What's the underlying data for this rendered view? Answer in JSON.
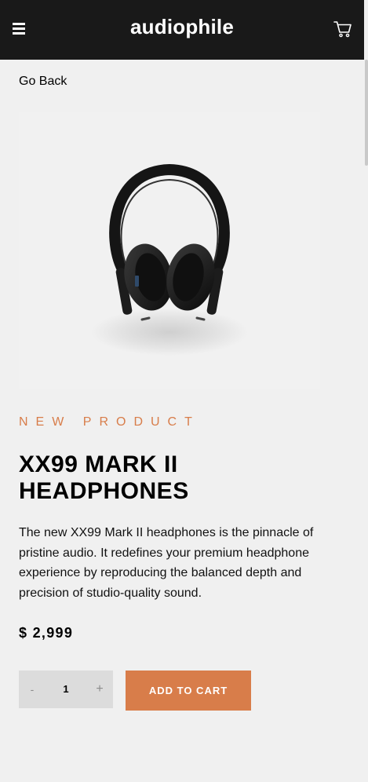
{
  "header": {
    "logo": "audiophile",
    "menu_icon": "hamburger-menu-icon",
    "cart_icon": "cart-icon"
  },
  "nav": {
    "go_back": "Go Back"
  },
  "product": {
    "overline": "NEW PRODUCT",
    "title_line1": "XX99 MARK II",
    "title_line2": "HEADPHONES",
    "description": "The new XX99 Mark II headphones is the pinnacle of pristine audio. It redefines your premium headphone experience by reproducing the balanced depth and precision of studio-quality sound.",
    "price": "$ 2,999",
    "image_icon": "headphones-image"
  },
  "quantity": {
    "minus": "-",
    "value": "1",
    "plus": "+"
  },
  "actions": {
    "add_to_cart": "ADD TO CART"
  },
  "colors": {
    "header_bg": "#191919",
    "page_bg": "#f0f0f0",
    "accent": "#d87d4a",
    "qty_bg": "#dcdcdc"
  }
}
